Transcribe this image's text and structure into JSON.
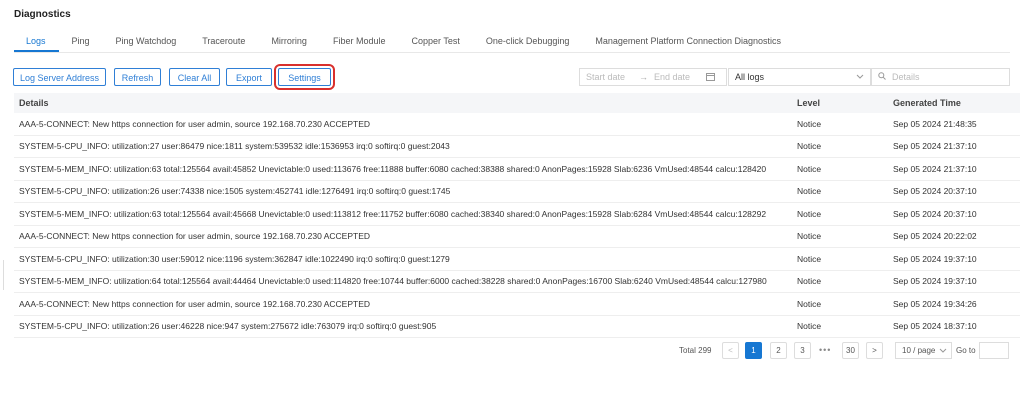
{
  "page": {
    "title": "Diagnostics"
  },
  "tabs": [
    {
      "label": "Logs",
      "active": true
    },
    {
      "label": "Ping"
    },
    {
      "label": "Ping Watchdog"
    },
    {
      "label": "Traceroute"
    },
    {
      "label": "Mirroring"
    },
    {
      "label": "Fiber Module"
    },
    {
      "label": "Copper Test"
    },
    {
      "label": "One-click Debugging"
    },
    {
      "label": "Management Platform Connection Diagnostics"
    }
  ],
  "toolbar": {
    "log_server_address": "Log Server Address",
    "refresh": "Refresh",
    "clear_all": "Clear All",
    "export": "Export",
    "settings": "Settings",
    "start_date": "Start date",
    "arrow": "→",
    "end_date": "End date",
    "log_filter": "All logs",
    "search_placeholder": "Details",
    "highlight_color": "#d9302d",
    "accent_color": "#1677d2"
  },
  "table": {
    "headers": {
      "details": "Details",
      "level": "Level",
      "time": "Generated Time"
    },
    "rows": [
      {
        "details": "AAA-5-CONNECT: New https connection for user admin, source 192.168.70.230 ACCEPTED",
        "level": "Notice",
        "time": "Sep 05 2024 21:48:35"
      },
      {
        "details": "SYSTEM-5-CPU_INFO: utilization:27 user:86479 nice:1811 system:539532 idle:1536953 irq:0 softirq:0 guest:2043",
        "level": "Notice",
        "time": "Sep 05 2024 21:37:10"
      },
      {
        "details": "SYSTEM-5-MEM_INFO: utilization:63 total:125564 avail:45852 Unevictable:0 used:113676 free:11888 buffer:6080 cached:38388 shared:0 AnonPages:15928 Slab:6236 VmUsed:48544 calcu:128420",
        "level": "Notice",
        "time": "Sep 05 2024 21:37:10"
      },
      {
        "details": "SYSTEM-5-CPU_INFO: utilization:26 user:74338 nice:1505 system:452741 idle:1276491 irq:0 softirq:0 guest:1745",
        "level": "Notice",
        "time": "Sep 05 2024 20:37:10"
      },
      {
        "details": "SYSTEM-5-MEM_INFO: utilization:63 total:125564 avail:45668 Unevictable:0 used:113812 free:11752 buffer:6080 cached:38340 shared:0 AnonPages:15928 Slab:6284 VmUsed:48544 calcu:128292",
        "level": "Notice",
        "time": "Sep 05 2024 20:37:10"
      },
      {
        "details": "AAA-5-CONNECT: New https connection for user admin, source 192.168.70.230 ACCEPTED",
        "level": "Notice",
        "time": "Sep 05 2024 20:22:02"
      },
      {
        "details": "SYSTEM-5-CPU_INFO: utilization:30 user:59012 nice:1196 system:362847 idle:1022490 irq:0 softirq:0 guest:1279",
        "level": "Notice",
        "time": "Sep 05 2024 19:37:10"
      },
      {
        "details": "SYSTEM-5-MEM_INFO: utilization:64 total:125564 avail:44464 Unevictable:0 used:114820 free:10744 buffer:6000 cached:38228 shared:0 AnonPages:16700 Slab:6240 VmUsed:48544 calcu:127980",
        "level": "Notice",
        "time": "Sep 05 2024 19:37:10"
      },
      {
        "details": "AAA-5-CONNECT: New https connection for user admin, source 192.168.70.230 ACCEPTED",
        "level": "Notice",
        "time": "Sep 05 2024 19:34:26"
      },
      {
        "details": "SYSTEM-5-CPU_INFO: utilization:26 user:46228 nice:947 system:275672 idle:763079 irq:0 softirq:0 guest:905",
        "level": "Notice",
        "time": "Sep 05 2024 18:37:10"
      }
    ]
  },
  "pagination": {
    "total": "Total 299",
    "prev": "<",
    "pages": [
      "1",
      "2",
      "3"
    ],
    "ellipsis": "•••",
    "last": "30",
    "next": ">",
    "page_size": "10 / page",
    "goto": "Go to"
  }
}
